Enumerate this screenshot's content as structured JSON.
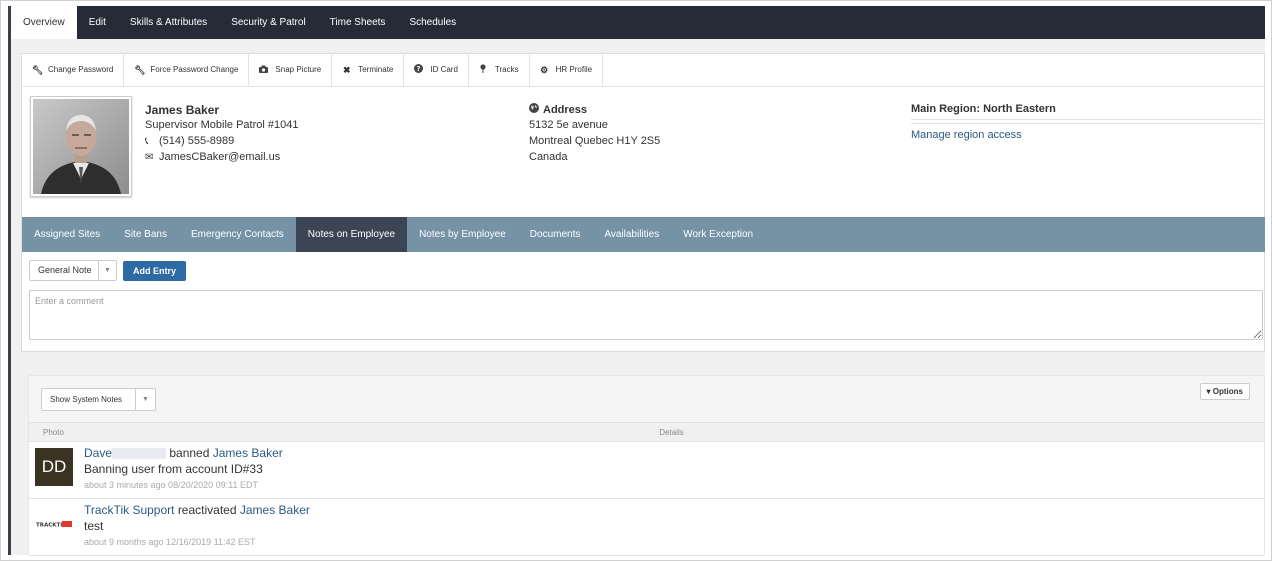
{
  "top_nav": {
    "tabs": [
      "Overview",
      "Edit",
      "Skills & Attributes",
      "Security & Patrol",
      "Time Sheets",
      "Schedules"
    ],
    "active": "Overview"
  },
  "toolbar": {
    "buttons": [
      {
        "icon": "wrench-icon",
        "label": "Change Password"
      },
      {
        "icon": "wrench-icon",
        "label": "Force Password Change"
      },
      {
        "icon": "camera-icon",
        "label": "Snap Picture"
      },
      {
        "icon": "close-icon",
        "label": "Terminate"
      },
      {
        "icon": "info-icon",
        "label": "ID Card"
      },
      {
        "icon": "map-pin-icon",
        "label": "Tracks"
      },
      {
        "icon": "gear-icon",
        "label": "HR Profile"
      }
    ]
  },
  "employee": {
    "name": "James Baker",
    "title": "Supervisor Mobile Patrol #1041",
    "phone": "(514) 555-8989",
    "email": "JamesCBaker@email.us"
  },
  "address": {
    "heading": "Address",
    "line1": "5132 5e avenue",
    "line2": "Montreal Quebec H1Y 2S5",
    "line3": "Canada"
  },
  "region": {
    "heading": "Main Region: North Eastern",
    "link": "Manage region access"
  },
  "sub_nav": {
    "tabs": [
      "Assigned Sites",
      "Site Bans",
      "Emergency Contacts",
      "Notes on Employee",
      "Notes by Employee",
      "Documents",
      "Availabilities",
      "Work Exception"
    ],
    "active": "Notes on Employee"
  },
  "note_form": {
    "type_value": "General Note",
    "add_label": "Add Entry",
    "comment_placeholder": "Enter a comment"
  },
  "notes": {
    "filter_value": "Show System Notes",
    "options_label": "▾ Options",
    "col_photo": "Photo",
    "col_details": "Details",
    "entries": [
      {
        "avatar_text": "DD",
        "actor": "Dave",
        "action": "banned",
        "target": "James Baker",
        "body": "Banning user from account ID#33",
        "meta": "about 3 minutes ago 08/20/2020 09:11 EDT"
      },
      {
        "avatar_text": "TRACKTIK",
        "actor": "TrackTik Support",
        "action": "reactivated",
        "target": "James Baker",
        "body": "test",
        "meta": "about 9 months ago 12/16/2019 11:42 EST"
      }
    ]
  },
  "colors": {
    "topnav_bg": "#262b38",
    "subnav_bg": "#7693a6",
    "subnav_active": "#3c4554",
    "primary_button": "#2e6aa3",
    "link": "#2a5a86"
  }
}
